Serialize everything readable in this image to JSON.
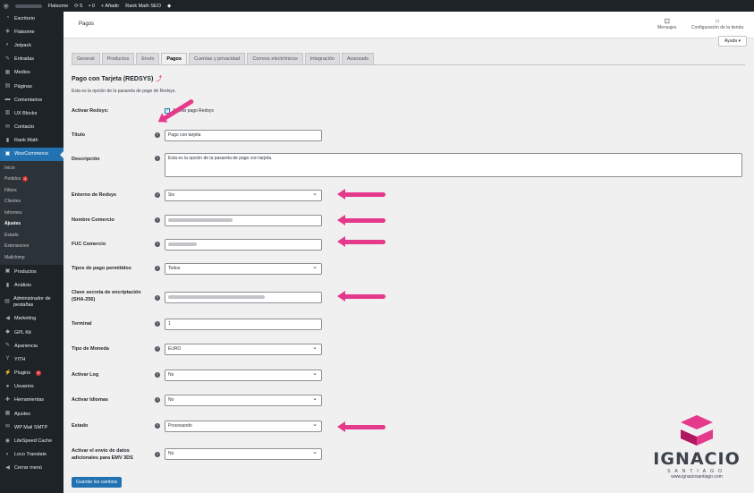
{
  "adminbar": {
    "site": "Flatsome",
    "updates": "5",
    "comments": "0",
    "add": "Añadir",
    "plugin": "Rank Math SEO"
  },
  "sidebar": {
    "items": [
      {
        "icon": "gauge",
        "label": "Escritorio"
      },
      {
        "icon": "flatsome",
        "label": "Flatsome"
      },
      {
        "icon": "jetpack",
        "label": "Jetpack"
      },
      {
        "icon": "pin",
        "label": "Entradas"
      },
      {
        "icon": "media",
        "label": "Medios"
      },
      {
        "icon": "page",
        "label": "Páginas"
      },
      {
        "icon": "comment",
        "label": "Comentarios"
      },
      {
        "icon": "blocks",
        "label": "UX Blocks"
      },
      {
        "icon": "mail",
        "label": "Contacto"
      },
      {
        "icon": "chart",
        "label": "Rank Math"
      }
    ],
    "active": "WooCommerce",
    "sub": [
      "Inicio",
      "Pedidos",
      "Filters",
      "Clientes",
      "Informes",
      "Ajustes",
      "Estado",
      "Extensiones",
      "Mailchimp"
    ],
    "orders_badge": "4",
    "items2": [
      {
        "icon": "box",
        "label": "Productos"
      },
      {
        "icon": "bars",
        "label": "Análisis"
      },
      {
        "icon": "tab",
        "label": "Administrador de pestañas"
      },
      {
        "icon": "megaphone",
        "label": "Marketing"
      },
      {
        "icon": "gpl",
        "label": "GPL Kit"
      },
      {
        "icon": "brush",
        "label": "Apariencia"
      },
      {
        "icon": "yith",
        "label": "YITH"
      },
      {
        "icon": "plug",
        "label": "Plugins"
      },
      {
        "icon": "user",
        "label": "Usuarios"
      },
      {
        "icon": "wrench",
        "label": "Herramientas"
      },
      {
        "icon": "settings",
        "label": "Ajustes"
      },
      {
        "icon": "mail",
        "label": "WP Mail SMTP"
      },
      {
        "icon": "speed",
        "label": "LiteSpeed Cache"
      },
      {
        "icon": "translate",
        "label": "Loco Translate"
      },
      {
        "icon": "collapse",
        "label": "Cerrar menú"
      }
    ],
    "plugins_badge": "5"
  },
  "topbar": {
    "title": "Pagos",
    "messages": "Mensajes",
    "store": "Configuración de la tienda",
    "help": "Ayuda ▾"
  },
  "tabs": [
    "General",
    "Productos",
    "Envío",
    "Pagos",
    "Cuentas y privacidad",
    "Correos electrónicos",
    "Integración",
    "Avanzado"
  ],
  "section": {
    "title": "Pago con Tarjeta (REDSYS)",
    "link": "⤴",
    "desc": "Esta es la opción de la pasarela de pago de Redsys."
  },
  "fields": {
    "activar": {
      "label": "Activar Redsys:",
      "check": "Activar pago Redsys"
    },
    "titulo": {
      "label": "Título",
      "value": "Pago con tarjeta"
    },
    "descripcion": {
      "label": "Descripción",
      "value": "Esta es la opción de la pasarela de pago con tarjeta."
    },
    "entorno": {
      "label": "Entorno de Redsys",
      "value": "Sis"
    },
    "nombre": {
      "label": "Nombre Comercio"
    },
    "fuc": {
      "label": "FUC Comercio"
    },
    "tipos": {
      "label": "Tipos de pago permitidos",
      "value": "Todos"
    },
    "clave": {
      "label": "Clave secreta de encriptación (SHA-256)"
    },
    "terminal": {
      "label": "Terminal",
      "value": "1"
    },
    "moneda": {
      "label": "Tipo de Moneda",
      "value": "EURO"
    },
    "log": {
      "label": "Activar Log",
      "value": "No"
    },
    "idiomas": {
      "label": "Activar Idiomas",
      "value": "No"
    },
    "estado": {
      "label": "Estado",
      "value": "Procesando"
    },
    "emv": {
      "label": "Activar el envío de datos adicionales para EMV 3DS",
      "value": "No"
    }
  },
  "save": "Guardar los cambios",
  "logo": {
    "word": "IGNACIO",
    "sub": "SANTIAGO",
    "url": "www.ignaciosantiago.com"
  },
  "colors": {
    "accent": "#2271b1",
    "arrow": "#e5398b"
  }
}
